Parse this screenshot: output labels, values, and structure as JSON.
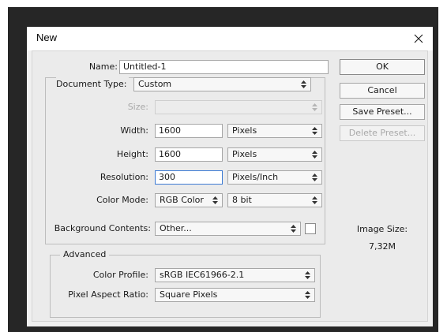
{
  "dialog": {
    "title": "New",
    "name": {
      "label": "Name:",
      "value": "Untitled-1"
    },
    "document_type": {
      "label": "Document Type:",
      "value": "Custom"
    },
    "size": {
      "label": "Size:",
      "value": ""
    },
    "width": {
      "label": "Width:",
      "value": "1600",
      "unit": "Pixels"
    },
    "height": {
      "label": "Height:",
      "value": "1600",
      "unit": "Pixels"
    },
    "resolution": {
      "label": "Resolution:",
      "value": "300",
      "unit": "Pixels/Inch"
    },
    "color_mode": {
      "label": "Color Mode:",
      "value": "RGB Color",
      "depth": "8 bit"
    },
    "background": {
      "label": "Background Contents:",
      "value": "Other...",
      "swatch_color": "#ffffff"
    },
    "advanced": {
      "legend": "Advanced",
      "color_profile": {
        "label": "Color Profile:",
        "value": "sRGB IEC61966-2.1"
      },
      "pixel_aspect": {
        "label": "Pixel Aspect Ratio:",
        "value": "Square Pixels"
      }
    },
    "buttons": {
      "ok": "OK",
      "cancel": "Cancel",
      "save_preset": "Save Preset...",
      "delete_preset": "Delete Preset..."
    },
    "image_size": {
      "label": "Image Size:",
      "value": "7,32M"
    }
  }
}
